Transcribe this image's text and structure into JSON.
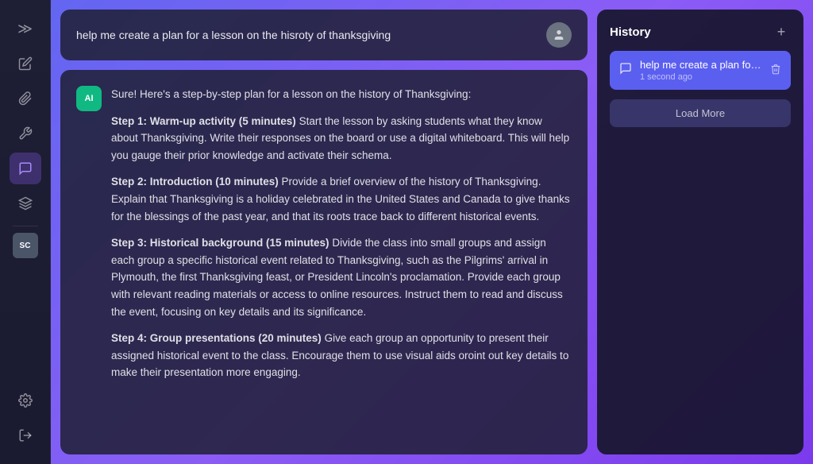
{
  "sidebar": {
    "icons": [
      {
        "name": "chevrons-icon",
        "symbol": "≫",
        "active": false
      },
      {
        "name": "edit-icon",
        "symbol": "✏",
        "active": false
      },
      {
        "name": "paperclip-icon",
        "symbol": "📎",
        "active": false
      },
      {
        "name": "tools-icon",
        "symbol": "✂",
        "active": false
      },
      {
        "name": "chat-icon",
        "symbol": "💬",
        "active": true
      },
      {
        "name": "layers-icon",
        "symbol": "⊞",
        "active": false
      }
    ],
    "bottom_icons": [
      {
        "name": "settings-icon",
        "symbol": "⚙",
        "active": false
      },
      {
        "name": "logout-icon",
        "symbol": "↗",
        "active": false
      }
    ],
    "avatar_label": "SC"
  },
  "user_message": {
    "text": "help me create a plan for a lesson on the hisroty of thanksgiving",
    "avatar": "👤"
  },
  "ai_response": {
    "avatar_label": "AI",
    "heading": "Sure! Here's a step-by-step plan for a lesson on the history of Thanksgiving:",
    "steps": [
      {
        "label": "Step 1: Warm-up activity (5 minutes)",
        "text": "Start the lesson by asking students what they know about Thanksgiving. Write their responses on the board or use a digital whiteboard. This will help you gauge their prior knowledge and activate their schema."
      },
      {
        "label": "Step 2: Introduction (10 minutes)",
        "text": "Provide a brief overview of the history of Thanksgiving. Explain that Thanksgiving is a holiday celebrated in the United States and Canada to give thanks for the blessings of the past year, and that its roots trace back to different historical events."
      },
      {
        "label": "Step 3: Historical background (15 minutes)",
        "text": "Divide the class into small groups and assign each group a specific historical event related to Thanksgiving, such as the Pilgrims' arrival in Plymouth, the first Thanksgiving feast, or President Lincoln's proclamation. Provide each group with relevant reading materials or access to online resources. Instruct them to read and discuss the event, focusing on key details and its significance."
      },
      {
        "label": "Step 4: Group presentations (20 minutes)",
        "text": "Give each group an opportunity to present their assigned historical event to the class. Encourage them to use visual aids oroint out key details to make their presentation more engaging."
      }
    ]
  },
  "history": {
    "title": "History",
    "add_button": "+",
    "item": {
      "text": "help me create a plan for a...",
      "time": "1 second ago"
    },
    "load_more_label": "Load More"
  }
}
